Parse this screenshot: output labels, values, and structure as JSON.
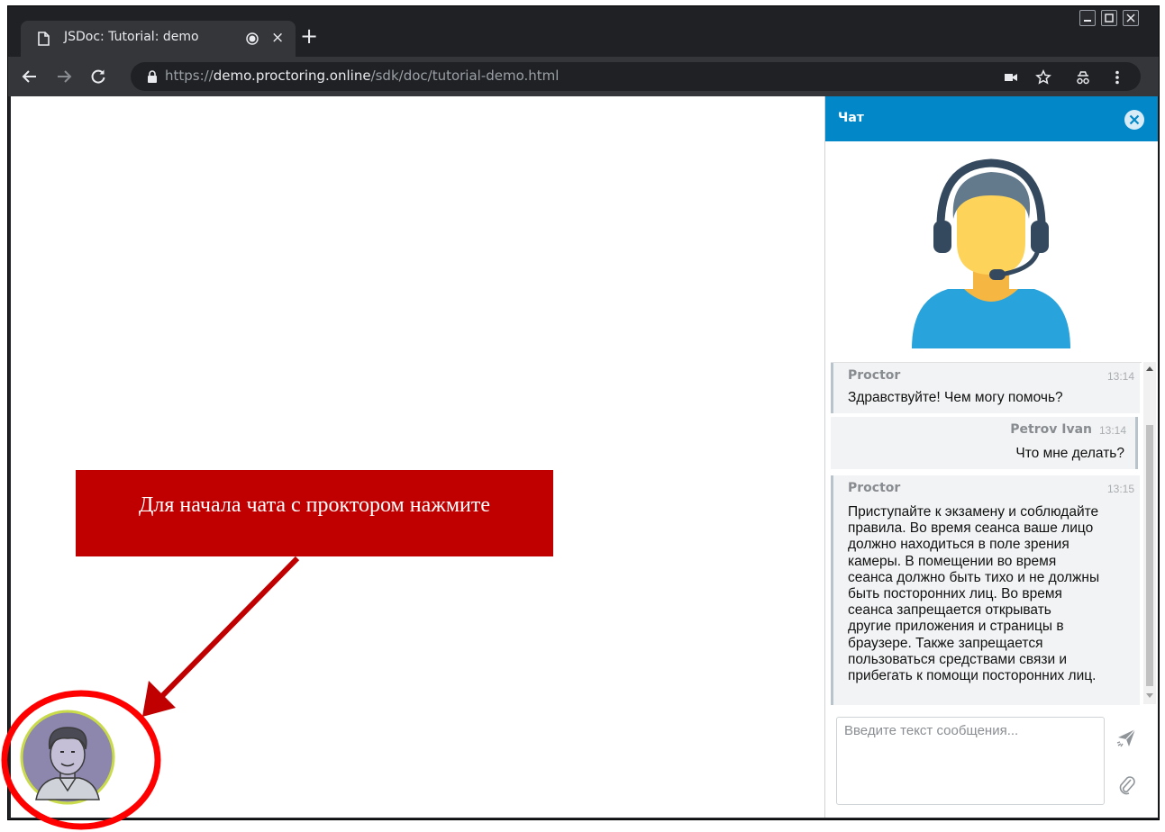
{
  "browser": {
    "tab_title": "JSDoc: Tutorial: demo",
    "tab_close_glyph": "×",
    "new_tab_glyph": "+",
    "url_scheme": "https://",
    "url_host": "demo.proctoring.online",
    "url_path": "/sdk/doc/tutorial-demo.html",
    "icons": [
      "page-icon",
      "recording-icon",
      "back-icon",
      "forward-icon",
      "reload-icon",
      "lock-icon",
      "camera-icon",
      "star-icon",
      "incognito-icon",
      "menu-icon",
      "minimize-icon",
      "maximize-icon",
      "close-window-icon"
    ]
  },
  "chat": {
    "title": "Чат",
    "messages": [
      {
        "author": "Proctor",
        "time": "13:14",
        "direction": "in",
        "lines": [
          "Здравствуйте! Чем могу помочь?"
        ]
      },
      {
        "author": "Petrov Ivan",
        "time": "13:14",
        "direction": "out",
        "lines": [
          "Что мне делать?"
        ]
      },
      {
        "author": "Proctor",
        "time": "13:15",
        "direction": "in",
        "lines": [
          "Приступайте к экзамену и соблюдайте",
          "правила. Во время сеанса ваше лицо",
          "должно находиться в поле зрения",
          "камеры. В помещении во время",
          "сеанса должно быть тихо и не должны",
          "быть посторонних лиц. Во время",
          "сеанса запрещается открывать",
          "другие приложения и страницы в",
          "браузере. Также запрещается",
          "пользоваться средствами связи и",
          "прибегать к помощи посторонних лиц."
        ]
      }
    ],
    "input_placeholder": "Введите текст сообщения...",
    "input_value": ""
  },
  "annotation": {
    "callout_text": "Для начала чата с проктором нажмите",
    "callout_color": "#c00000"
  },
  "colors": {
    "chat_header": "#0288c8",
    "browser_frame": "#202124",
    "toolbar": "#35363a"
  }
}
